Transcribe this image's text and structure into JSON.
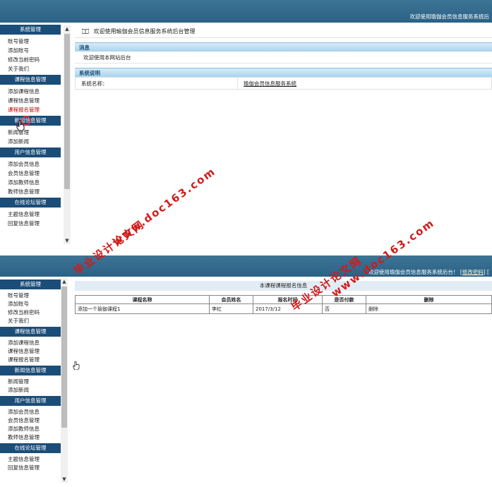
{
  "header": {
    "greeting_top": "欢迎使用瑜伽会员信息服务系统后",
    "greeting_bottom": "欢迎使用瑜伽会员信息服务系统后台！ [",
    "password_link": "修改密码",
    "bracket_close": "] ["
  },
  "sidebar": {
    "groups": [
      {
        "title": "系统管理",
        "items": [
          "账号管理",
          "添加账号",
          "修改当前密码",
          "关于我们"
        ]
      },
      {
        "title": "课程信息管理",
        "items": [
          "添加课程信息",
          "课程信息管理",
          "课程报名管理"
        ]
      },
      {
        "title": "新闻信息管理",
        "items": [
          "新闻管理",
          "添加新闻"
        ]
      },
      {
        "title": "用户信息管理",
        "items": [
          "添加会员信息",
          "会员信息管理",
          "添加教师信息",
          "教师信息管理"
        ]
      },
      {
        "title": "在线论坛管理",
        "items": [
          "主题信息管理",
          "回复信息管理"
        ]
      }
    ]
  },
  "scroll": {
    "up": "▲",
    "down": "▼"
  },
  "home": {
    "breadcrumb": "欢迎使用瑜伽会员信息服务系统后台管理",
    "message_head": "消息",
    "message_body": "欢迎使用本网站后台",
    "system_head": "系统说明",
    "system_name_label": "系统名称：",
    "system_name_value": "瑜伽会员信息服务系统"
  },
  "list": {
    "title": "本课程课程报名信息",
    "columns": [
      "课程名称",
      "会员姓名",
      "报名时间",
      "是否付款",
      "删除"
    ],
    "rows": [
      {
        "course": "添加一个瑜伽课程1",
        "member": "李红",
        "time": "2017/3/12",
        "paid": "否",
        "delete": "删除"
      }
    ]
  },
  "watermarks": {
    "line1": "毕业设计论文网",
    "line2": "www.doc163.com"
  },
  "colors": {
    "topbar": "#2b6185",
    "sidebar_head": "#1b4d79",
    "active_item": "#cc0000",
    "watermark": "#d21a1a"
  }
}
